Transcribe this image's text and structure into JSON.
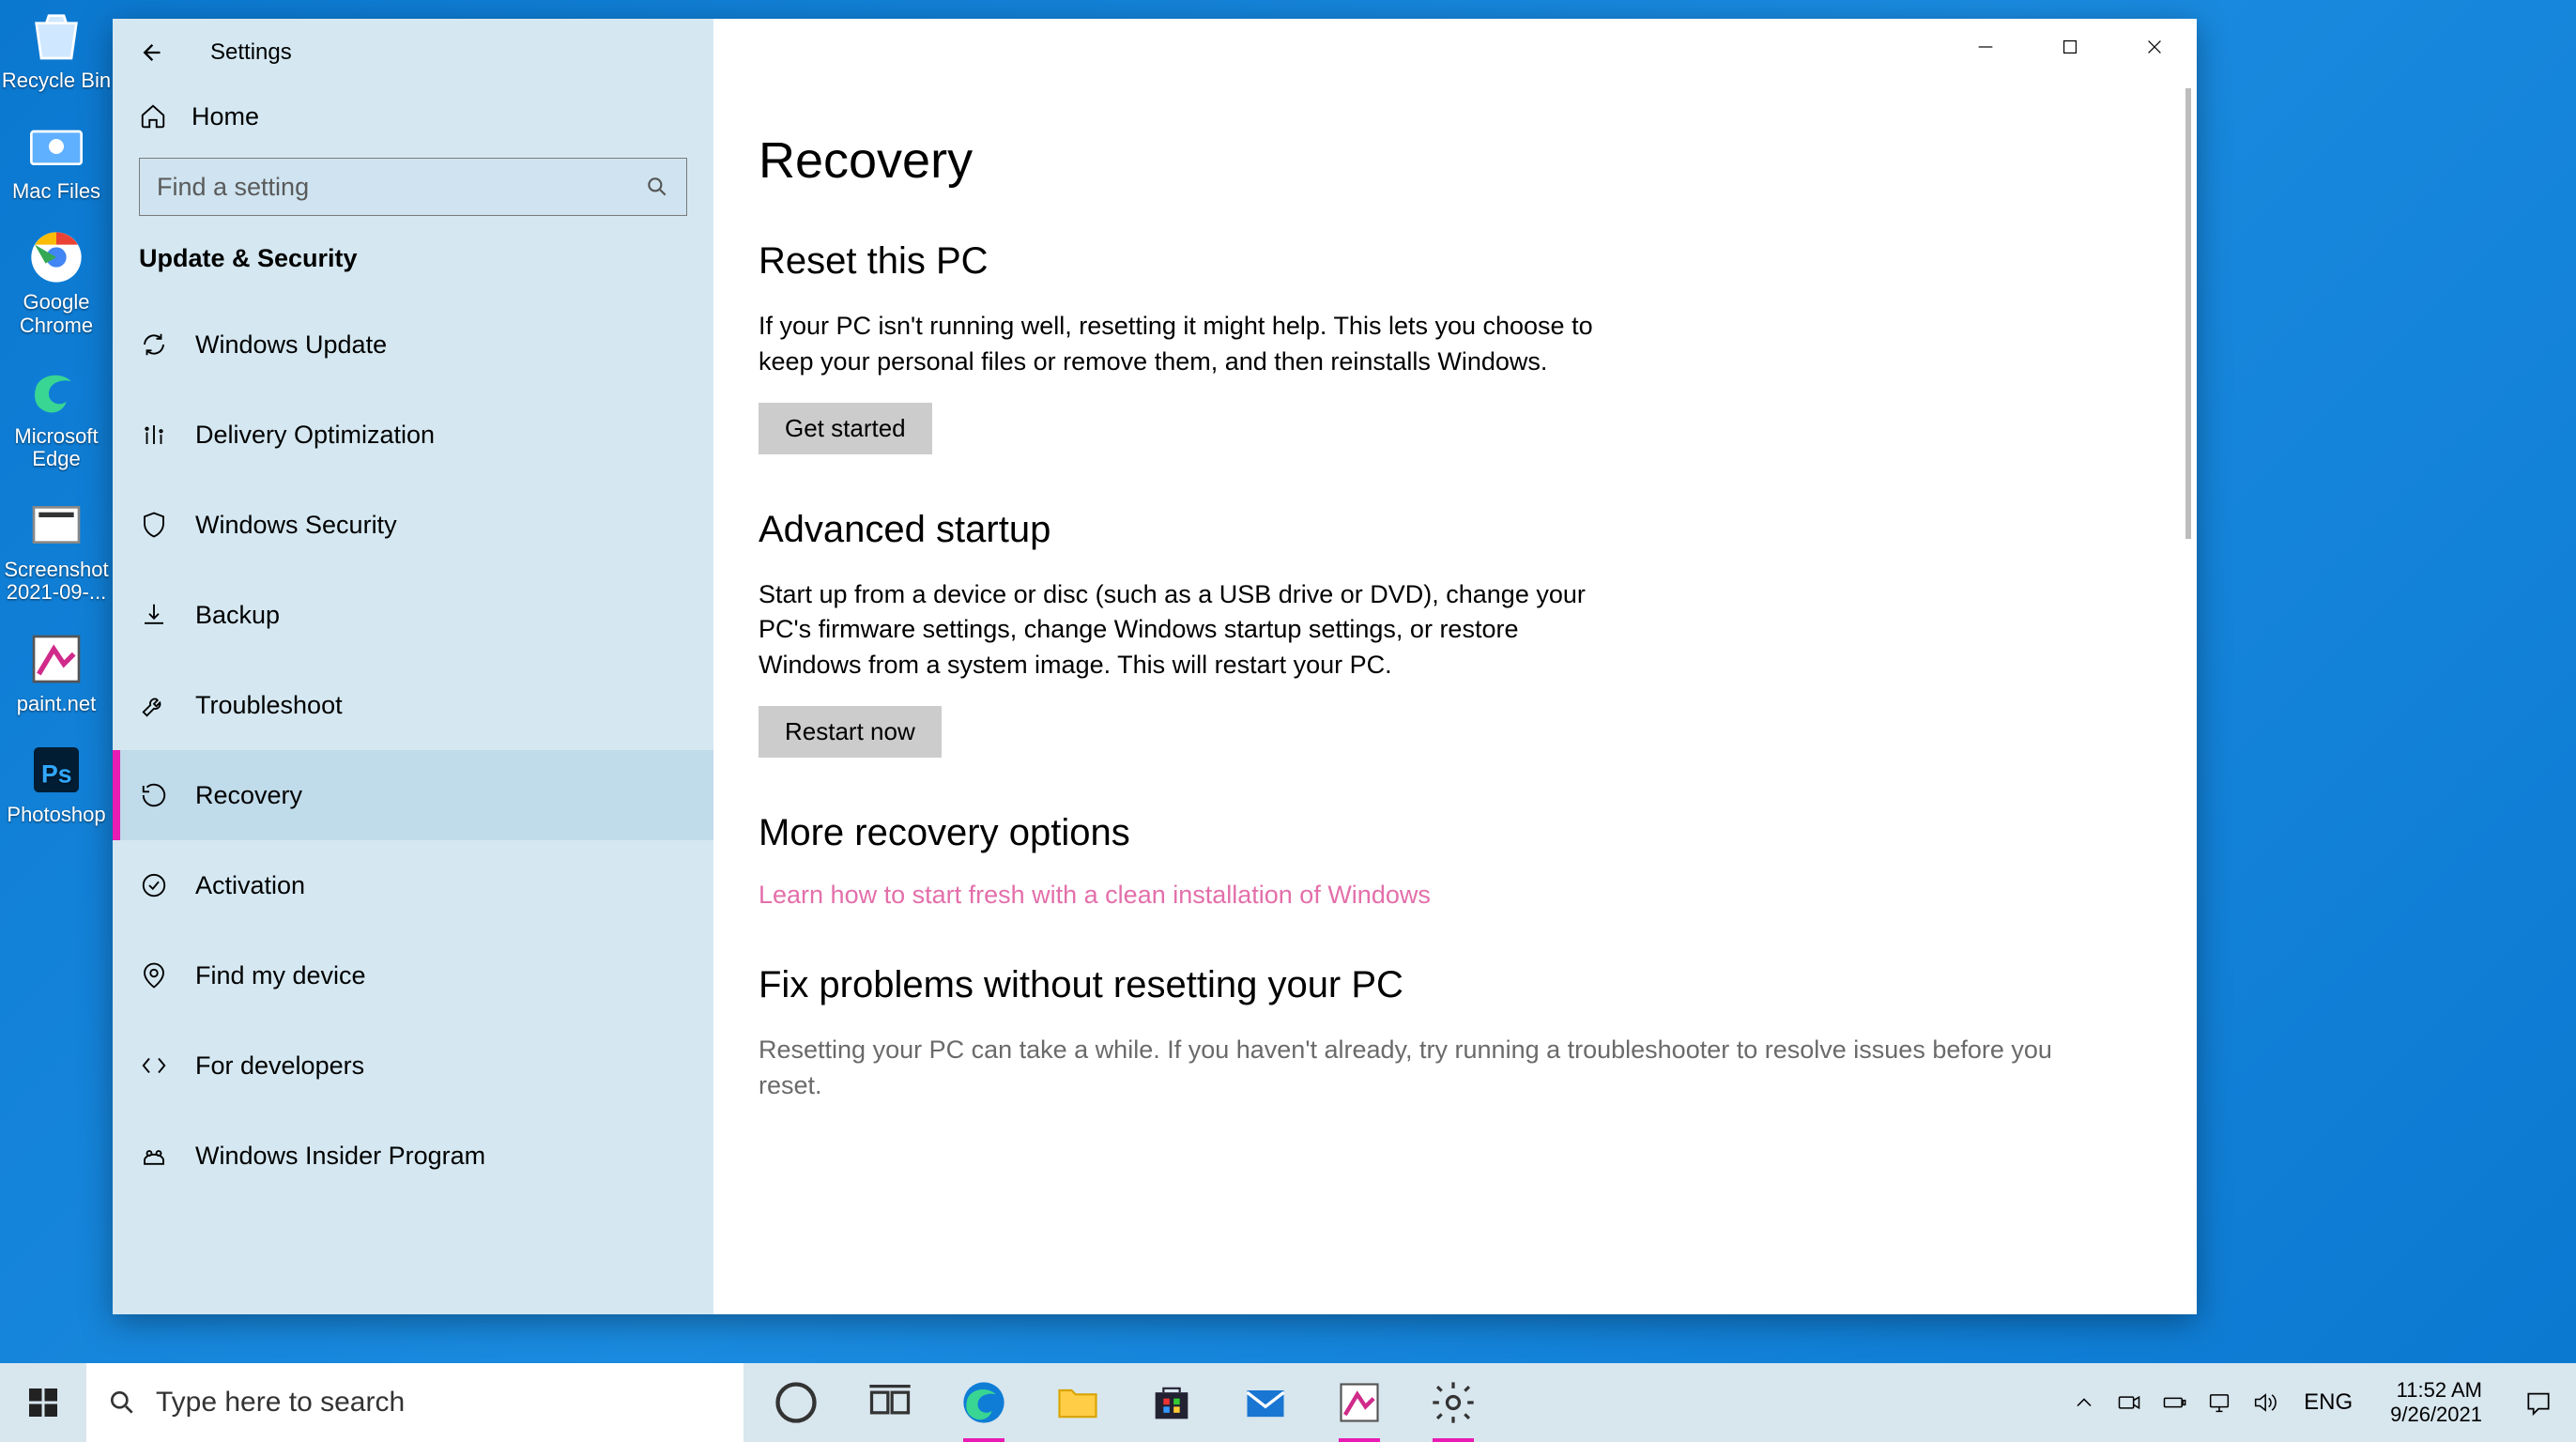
{
  "desktop": {
    "icons": [
      {
        "label": "Recycle Bin"
      },
      {
        "label": "Mac Files"
      },
      {
        "label": "Google Chrome"
      },
      {
        "label": "Microsoft Edge"
      },
      {
        "label": "Screenshot 2021-09-..."
      },
      {
        "label": "paint.net"
      },
      {
        "label": "Photoshop"
      }
    ]
  },
  "window": {
    "app_title": "Settings",
    "home_label": "Home",
    "search_placeholder": "Find a setting",
    "category": "Update & Security",
    "nav": [
      {
        "label": "Windows Update"
      },
      {
        "label": "Delivery Optimization"
      },
      {
        "label": "Windows Security"
      },
      {
        "label": "Backup"
      },
      {
        "label": "Troubleshoot"
      },
      {
        "label": "Recovery"
      },
      {
        "label": "Activation"
      },
      {
        "label": "Find my device"
      },
      {
        "label": "For developers"
      },
      {
        "label": "Windows Insider Program"
      }
    ],
    "selected_nav_index": 5,
    "page": {
      "title": "Recovery",
      "sections": [
        {
          "heading": "Reset this PC",
          "body": "If your PC isn't running well, resetting it might help. This lets you choose to keep your personal files or remove them, and then reinstalls Windows.",
          "button": "Get started"
        },
        {
          "heading": "Advanced startup",
          "body": "Start up from a device or disc (such as a USB drive or DVD), change your PC's firmware settings, change Windows startup settings, or restore Windows from a system image. This will restart your PC.",
          "button": "Restart now"
        },
        {
          "heading": "More recovery options",
          "link": "Learn how to start fresh with a clean installation of Windows"
        },
        {
          "heading": "Fix problems without resetting your PC",
          "body_muted": "Resetting your PC can take a while. If you haven't already, try running a troubleshooter to resolve issues before you reset."
        }
      ]
    }
  },
  "taskbar": {
    "search_placeholder": "Type here to search",
    "lang": "ENG",
    "time": "11:52 AM",
    "date": "9/26/2021"
  }
}
